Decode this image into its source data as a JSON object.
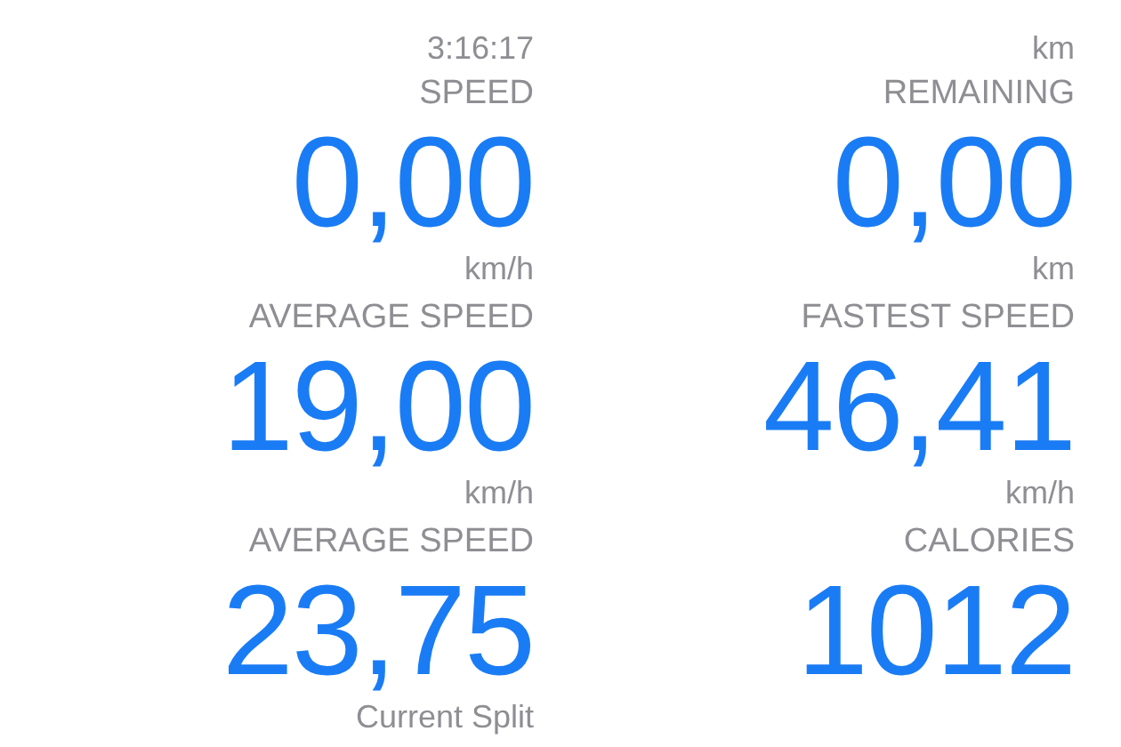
{
  "metrics": [
    {
      "unit": "3:16:17"
    },
    {
      "unit": "km"
    },
    {
      "label": "SPEED",
      "value": "0,00",
      "unit": "km/h"
    },
    {
      "label": "REMAINING",
      "value": "0,00",
      "unit": "km"
    },
    {
      "label": "AVERAGE SPEED",
      "value": "19,00",
      "unit": "km/h"
    },
    {
      "label": "FASTEST SPEED",
      "value": "46,41",
      "unit": "km/h"
    },
    {
      "label": "AVERAGE SPEED",
      "value": "23,75",
      "unit": "Current Split"
    },
    {
      "label": "CALORIES",
      "value": "1012"
    }
  ]
}
